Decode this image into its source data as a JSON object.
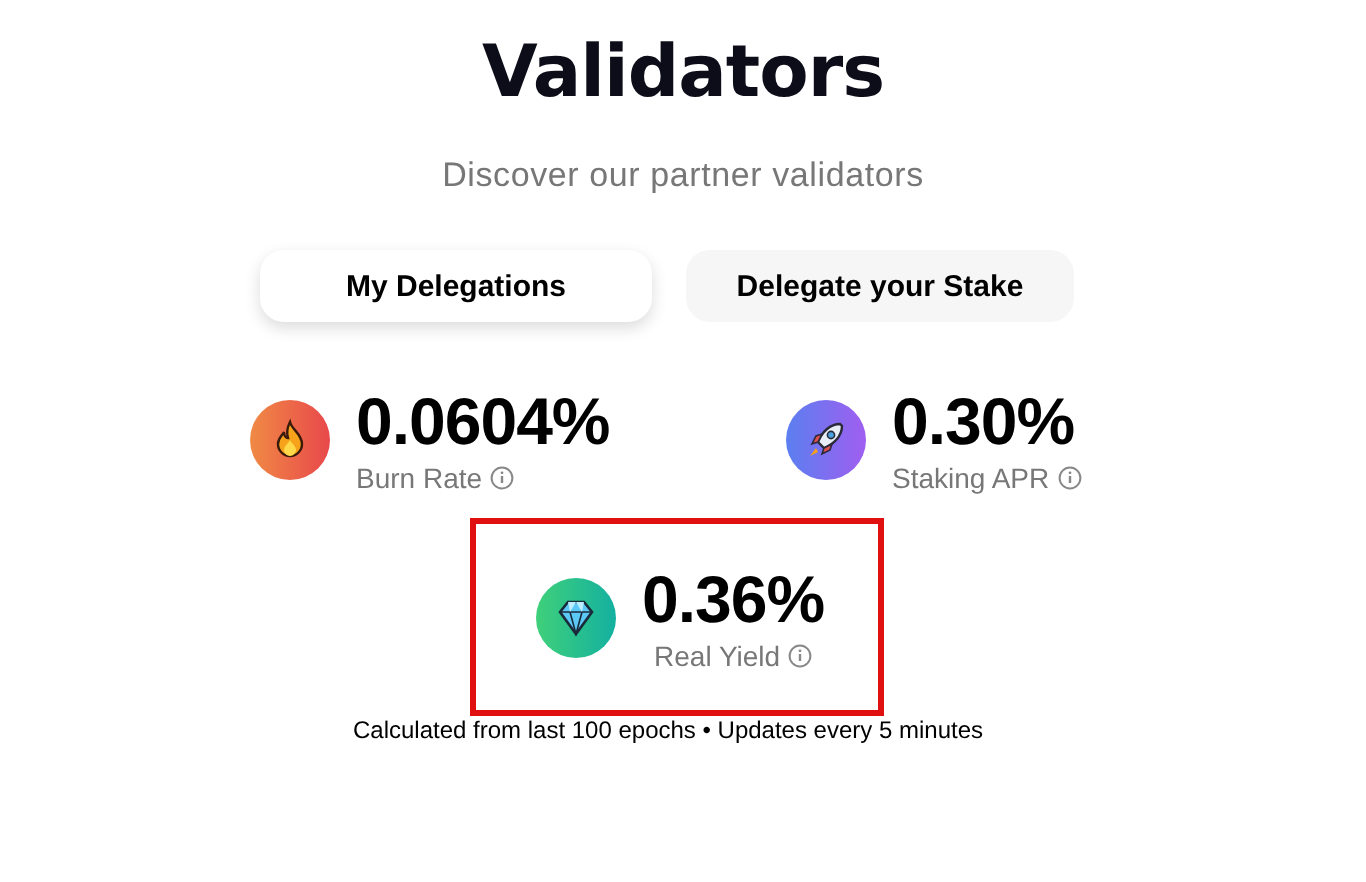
{
  "header": {
    "title": "Validators",
    "subtitle": "Discover our partner validators"
  },
  "tabs": [
    {
      "label": "My Delegations",
      "selected": true
    },
    {
      "label": "Delegate your Stake",
      "selected": false
    }
  ],
  "stats": [
    {
      "kind": "fire",
      "value": "0.0604%",
      "label": "Burn Rate",
      "highlighted": false
    },
    {
      "kind": "rocket",
      "value": "0.30%",
      "label": "Staking APR",
      "highlighted": false
    },
    {
      "kind": "gem",
      "value": "0.36%",
      "label": "Real Yield",
      "highlighted": true
    }
  ],
  "footnote": "Calculated from last 100 epochs • Updates every 5 minutes"
}
